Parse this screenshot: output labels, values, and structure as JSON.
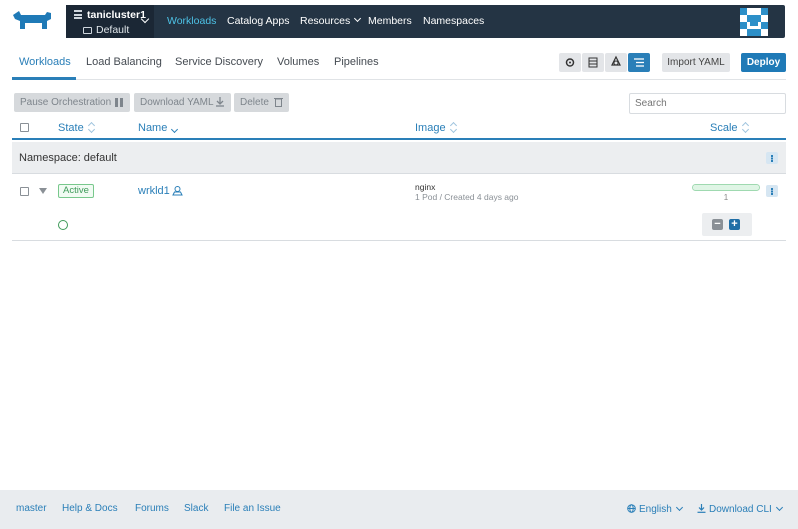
{
  "header": {
    "cluster_name": "tanicluster1",
    "project_name": "Default",
    "nav": [
      {
        "label": "Workloads",
        "active": true
      },
      {
        "label": "Catalog Apps"
      },
      {
        "label": "Resources",
        "dropdown": true
      },
      {
        "label": "Members"
      },
      {
        "label": "Namespaces"
      }
    ]
  },
  "tabs": [
    "Workloads",
    "Load Balancing",
    "Service Discovery",
    "Volumes",
    "Pipelines"
  ],
  "toolbar": {
    "views": [
      "gear-icon",
      "list-icon",
      "namespace-icon",
      "grouped-list-icon"
    ],
    "active_view": "grouped-list-icon",
    "import_label": "Import YAML",
    "deploy_label": "Deploy"
  },
  "bulk_actions": {
    "pause_label": "Pause Orchestration",
    "download_label": "Download YAML",
    "delete_label": "Delete"
  },
  "search": {
    "placeholder": "Search"
  },
  "table": {
    "headers": {
      "state": "State",
      "name": "Name",
      "image": "Image",
      "scale": "Scale"
    },
    "groups": [
      {
        "namespace_label": "Namespace: default",
        "rows": [
          {
            "state": "Active",
            "name": "wrkld1",
            "image": "nginx",
            "detail": "1 Pod / Created 4 days ago",
            "scale": "1",
            "minus": "−",
            "plus": "+"
          }
        ]
      }
    ]
  },
  "footer": {
    "version": "master",
    "help": "Help & Docs",
    "forums": "Forums",
    "slack": "Slack",
    "issue": "File an Issue",
    "language": "English",
    "download_cli": "Download CLI"
  },
  "colors": {
    "accent": "#2a7fb8",
    "nav_bg": "#243444",
    "active_state": "#3f9b5a"
  }
}
